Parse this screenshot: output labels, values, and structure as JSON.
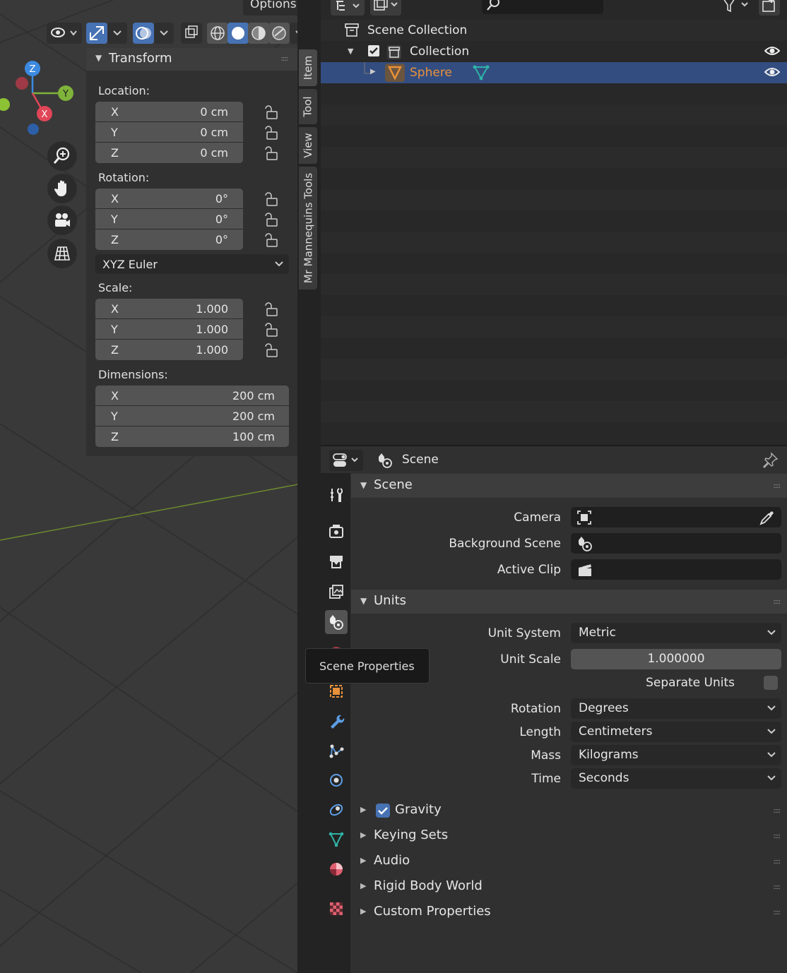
{
  "viewport": {
    "options_label": "Options",
    "gizmo": {
      "z": "Z",
      "y": "Y",
      "x": "X"
    },
    "transform": {
      "title": "Transform",
      "location_label": "Location:",
      "location": [
        {
          "axis": "X",
          "value": "0 cm"
        },
        {
          "axis": "Y",
          "value": "0 cm"
        },
        {
          "axis": "Z",
          "value": "0 cm"
        }
      ],
      "rotation_label": "Rotation:",
      "rotation": [
        {
          "axis": "X",
          "value": "0°"
        },
        {
          "axis": "Y",
          "value": "0°"
        },
        {
          "axis": "Z",
          "value": "0°"
        }
      ],
      "rotation_mode": "XYZ Euler",
      "scale_label": "Scale:",
      "scale": [
        {
          "axis": "X",
          "value": "1.000"
        },
        {
          "axis": "Y",
          "value": "1.000"
        },
        {
          "axis": "Z",
          "value": "1.000"
        }
      ],
      "dimensions_label": "Dimensions:",
      "dimensions": [
        {
          "axis": "X",
          "value": "200 cm"
        },
        {
          "axis": "Y",
          "value": "200 cm"
        },
        {
          "axis": "Z",
          "value": "100 cm"
        }
      ]
    },
    "tabs": [
      "Item",
      "Tool",
      "View",
      "Mr Mannequins Tools"
    ]
  },
  "outliner": {
    "rows": [
      {
        "label": "Scene Collection"
      },
      {
        "label": "Collection"
      },
      {
        "label": "Sphere"
      }
    ]
  },
  "properties": {
    "header_title": "Scene",
    "scene_panel": {
      "title": "Scene",
      "camera_label": "Camera",
      "background_scene_label": "Background Scene",
      "active_clip_label": "Active Clip"
    },
    "units_panel": {
      "title": "Units",
      "unit_system_label": "Unit System",
      "unit_system": "Metric",
      "unit_scale_label": "Unit Scale",
      "unit_scale": "1.000000",
      "separate_units_label": "Separate Units",
      "rotation_label": "Rotation",
      "rotation": "Degrees",
      "length_label": "Length",
      "length": "Centimeters",
      "mass_label": "Mass",
      "mass": "Kilograms",
      "time_label": "Time",
      "time": "Seconds"
    },
    "collapsed_panels": [
      "Gravity",
      "Keying Sets",
      "Audio",
      "Rigid Body World",
      "Custom Properties"
    ],
    "tooltip": "Scene Properties"
  },
  "colors": {
    "selection": "#334d80",
    "accent_blue": "#4772b3",
    "object_orange": "#e8913a",
    "mesh_teal": "#2fb3a5"
  }
}
